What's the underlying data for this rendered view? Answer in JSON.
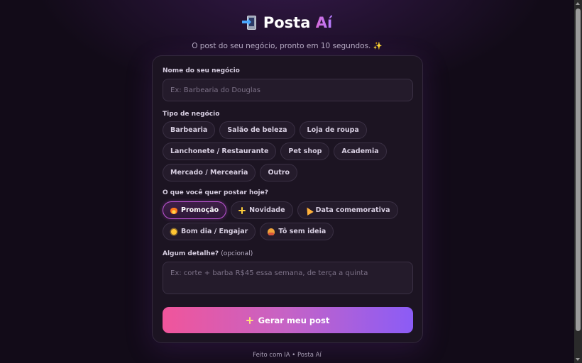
{
  "header": {
    "brand_main": "Posta",
    "brand_accent": "Aí",
    "brand_icon": "mobile-phone-arrow-icon",
    "tagline": "O post do seu negócio, pronto em 10 segundos. ✨"
  },
  "form": {
    "business_name": {
      "label": "Nome do seu negócio",
      "value": "",
      "placeholder": "Ex: Barbearia do Douglas"
    },
    "business_type": {
      "label": "Tipo de negócio",
      "options": [
        "Barbearia",
        "Salão de beleza",
        "Loja de roupa",
        "Lanchonete / Restaurante",
        "Pet shop",
        "Academia",
        "Mercado / Mercearia",
        "Outro"
      ]
    },
    "post_goal": {
      "label": "O que você quer postar hoje?",
      "selected": "Promoção",
      "options": [
        {
          "label": "Promoção",
          "icon": "fire-icon"
        },
        {
          "label": "Novidade",
          "icon": "sparkles-icon"
        },
        {
          "label": "Data comemorativa",
          "icon": "party-popper-icon"
        },
        {
          "label": "Bom dia / Engajar",
          "icon": "sun-icon"
        },
        {
          "label": "Tô sem ideia",
          "icon": "shrug-icon"
        }
      ]
    },
    "details": {
      "label": "Algum detalhe?",
      "label_optional": "(opcional)",
      "value": "",
      "placeholder": "Ex: corte + barba R$45 essa semana, de terça a quinta"
    },
    "submit_label": "Gerar meu post"
  },
  "footer": {
    "text": "Feito com IA • Posta Aí"
  },
  "colors": {
    "background": "#120b18",
    "card": "#1c1422",
    "accent_pink": "#f0559b",
    "accent_purple": "#8b5cf6",
    "selected_border": "#c155d8"
  }
}
